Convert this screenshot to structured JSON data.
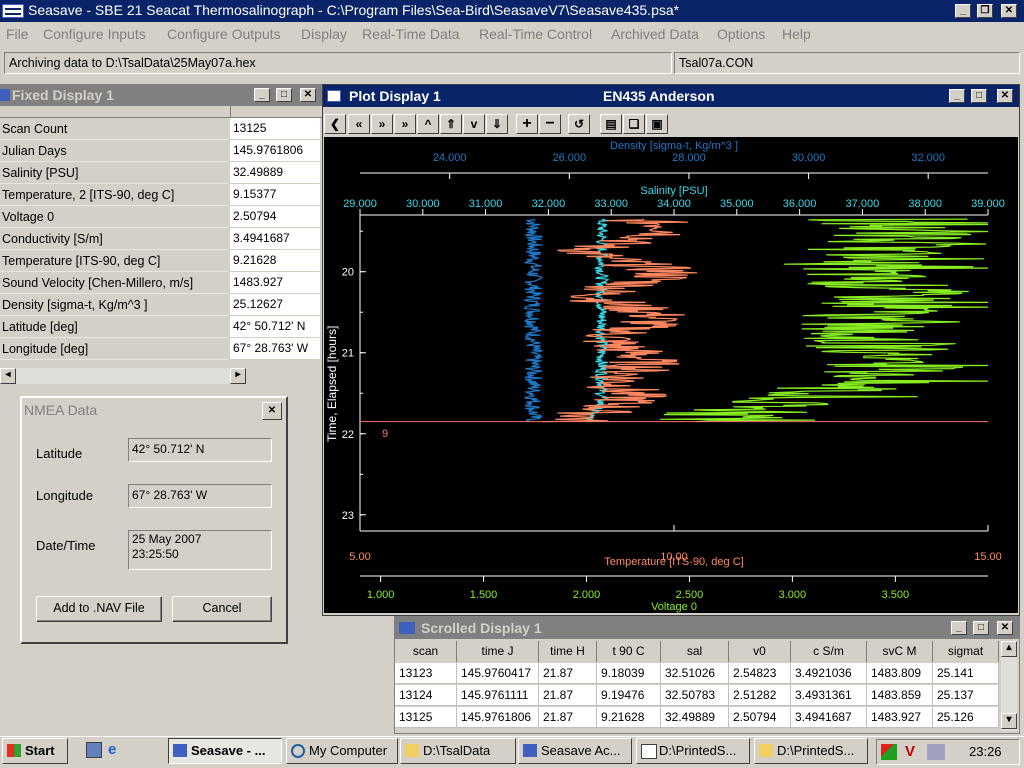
{
  "app": {
    "title": "Seasave - SBE 21 Seacat Thermosalinograph - C:\\Program Files\\Sea-Bird\\SeasaveV7\\Seasave435.psa*",
    "menu": [
      "File",
      "Configure Inputs",
      "Configure Outputs",
      "Display",
      "Real-Time Data",
      "Real-Time Control",
      "Archived Data",
      "Options",
      "Help"
    ],
    "status_left": "Archiving data to D:\\TsalData\\25May07a.hex",
    "status_right": "Tsal07a.CON",
    "colors": {
      "titlebar_active": "#0a246a",
      "titlebar_inactive": "#808080",
      "face": "#d4d0c8"
    }
  },
  "fixed_display": {
    "title": "Fixed Display 1",
    "rows": [
      {
        "label": "Scan Count",
        "value": "13125"
      },
      {
        "label": "Julian Days",
        "value": "145.9761806"
      },
      {
        "label": "Salinity [PSU]",
        "value": "32.49889"
      },
      {
        "label": "Temperature, 2 [ITS-90, deg C]",
        "value": "9.15377"
      },
      {
        "label": "Voltage 0",
        "value": "2.50794"
      },
      {
        "label": "Conductivity [S/m]",
        "value": "3.4941687"
      },
      {
        "label": "Temperature [ITS-90, deg C]",
        "value": "9.21628"
      },
      {
        "label": "Sound Velocity [Chen-Millero, m/s]",
        "value": "1483.927"
      },
      {
        "label": "Density [sigma-t, Kg/m^3 ]",
        "value": "25.12627"
      },
      {
        "label": "Latitude [deg]",
        "value": " 42° 50.712' N"
      },
      {
        "label": "Longitude [deg]",
        "value": " 67° 28.763' W"
      }
    ]
  },
  "nmea": {
    "title": "NMEA Data",
    "latitude_label": "Latitude",
    "latitude_value": "42° 50.712' N",
    "longitude_label": "Longitude",
    "longitude_value": "67° 28.763' W",
    "datetime_label": "Date/Time",
    "date_value": "25 May 2007",
    "time_value": "23:25:50",
    "add_button": "Add to .NAV File",
    "cancel_button": "Cancel"
  },
  "plot": {
    "title": "Plot Display 1",
    "subtitle": "EN435 Anderson",
    "toolbar_icons": [
      "first-icon",
      "prev-icon",
      "next-icon",
      "last-icon",
      "up-icon",
      "top-icon",
      "down-icon",
      "bottom-icon",
      "zoom-in-icon",
      "zoom-out-icon",
      "refresh-icon",
      "print-icon",
      "copy-icon",
      "save-icon"
    ],
    "marker_label": "9"
  },
  "chart_data": {
    "type": "line",
    "title": "",
    "yaxis": {
      "label": "Time, Elapsed [hours]",
      "range": [
        19.3,
        23.2
      ],
      "ticks": [
        "20",
        "21",
        "22",
        "23"
      ],
      "inverted": true
    },
    "x_axes": [
      {
        "label": "Density [sigma-t, Kg/m^3 ]",
        "range": [
          22.5,
          33.0
        ],
        "ticks": [
          "24.000",
          "26.000",
          "28.000",
          "30.000",
          "32.000"
        ],
        "color": "#1e78c8"
      },
      {
        "label": "Salinity [PSU]",
        "range": [
          29.0,
          39.0
        ],
        "ticks": [
          "29.000",
          "30.000",
          "31.000",
          "32.000",
          "33.000",
          "34.000",
          "35.000",
          "36.000",
          "37.000",
          "38.000",
          "39.000"
        ],
        "color": "#38d8e8"
      },
      {
        "label": "Temperature [ITS-90, deg C]",
        "range": [
          5.0,
          15.0
        ],
        "ticks": [
          "5.00",
          "10.00",
          "15.00"
        ],
        "color": "#ff8860"
      },
      {
        "label": "Voltage 0",
        "range": [
          0.9,
          3.95
        ],
        "ticks": [
          "1.000",
          "1.500",
          "2.000",
          "2.500",
          "3.000",
          "3.500"
        ],
        "color": "#88ee22"
      }
    ],
    "series": [
      {
        "name": "Density [sigma-t, Kg/m^3 ]",
        "color": "#1e78c8",
        "t_range": [
          19.35,
          21.85
        ],
        "x_center": 25.4,
        "x_jitter": 0.15
      },
      {
        "name": "Salinity [PSU]",
        "color": "#38d8e8",
        "t_range": [
          19.35,
          21.85
        ],
        "x_center": 32.85,
        "x_jitter": 0.1
      },
      {
        "name": "Temperature [ITS-90, deg C]",
        "color": "#ff8860",
        "t_range": [
          19.35,
          21.85
        ],
        "x_center": 9.3,
        "x_jitter": 0.6
      },
      {
        "name": "Voltage 0",
        "color": "#88ee22",
        "t_range": [
          19.35,
          21.85
        ],
        "x_center": 3.4,
        "x_jitter": 0.35
      }
    ],
    "marker_time": 21.85,
    "background": "#000000"
  },
  "scrolled_display": {
    "title": "Scrolled Display 1",
    "columns": [
      "scan",
      "time J",
      "time H",
      "t 90 C",
      "sal",
      "v0",
      "c S/m",
      "svC M",
      "sigmat"
    ],
    "rows": [
      [
        "13123",
        "145.9760417",
        "21.87",
        "9.18039",
        "32.51026",
        "2.54823",
        "3.4921036",
        "1483.809",
        "25.141"
      ],
      [
        "13124",
        "145.9761111",
        "21.87",
        "9.19476",
        "32.50783",
        "2.51282",
        "3.4931361",
        "1483.859",
        "25.137"
      ],
      [
        "13125",
        "145.9761806",
        "21.87",
        "9.21628",
        "32.49889",
        "2.50794",
        "3.4941687",
        "1483.927",
        "25.126"
      ]
    ]
  },
  "taskbar": {
    "start": "Start",
    "items": [
      "Seasave - ...",
      "My Computer",
      "D:\\TsalData",
      "Seasave Ac...",
      "D:\\PrintedS...",
      "D:\\PrintedS..."
    ],
    "clock": "23:26"
  }
}
